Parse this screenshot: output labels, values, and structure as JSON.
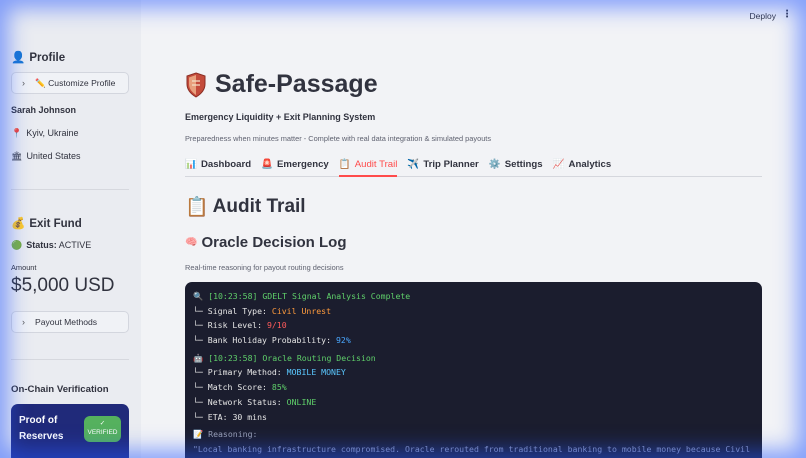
{
  "header": {
    "deploy_label": "Deploy",
    "menu_icon": "⋮"
  },
  "sidebar": {
    "profile_heading": "Profile",
    "profile_icon": "👤",
    "customize_button": "✏️ Customize Profile",
    "user_name": "Sarah Johnson",
    "location": "Kyiv, Ukraine",
    "location_icon": "📍",
    "citizenship": "United States",
    "citizenship_icon": "🏛",
    "exit_fund_heading": "Exit Fund",
    "exit_fund_icon": "💰",
    "status_label": "Status:",
    "status_value": "ACTIVE",
    "status_icon": "🟢",
    "amount_label": "Amount",
    "amount_value": "$5,000 USD",
    "payout_button": "Payout Methods",
    "onchain_heading": "On-Chain Verification",
    "proof_title": "Proof of Reserves",
    "verified_check": "✓",
    "verified_label": "VERIFIED",
    "proof_color": "#202a7a",
    "verified_color": "#55b15e"
  },
  "main": {
    "app_title": "Safe-Passage",
    "subtitle": "Emergency Liquidity + Exit Planning System",
    "caption": "Preparedness when minutes matter - Complete with real data integration & simulated payouts",
    "tabs": [
      {
        "icon": "📊",
        "label": "Dashboard"
      },
      {
        "icon": "🚨",
        "label": "Emergency"
      },
      {
        "icon": "📋",
        "label": "Audit Trail"
      },
      {
        "icon": "✈️",
        "label": "Trip Planner"
      },
      {
        "icon": "⚙️",
        "label": "Settings"
      },
      {
        "icon": "📈",
        "label": "Analytics"
      }
    ],
    "active_tab": "Audit Trail",
    "accent_color": "#ff4b4b",
    "section_title": "Audit Trail",
    "section_icon": "📋",
    "sub_title": "Oracle Decision Log",
    "sub_icon": "🧠",
    "sub_caption": "Real-time reasoning for payout routing decisions"
  },
  "console": {
    "signal_icon": "🔍",
    "signal_header": "[10:23:58] GDELT Signal Analysis Complete",
    "signal_type_label": "└─ Signal Type:",
    "signal_type_value": "Civil Unrest",
    "risk_label": "└─ Risk Level:",
    "risk_value": "9/10",
    "holiday_label": "└─ Bank Holiday Probability:",
    "holiday_value": "92%",
    "routing_icon": "🤖",
    "routing_header": "[10:23:58] Oracle Routing Decision",
    "method_label": "└─ Primary Method:",
    "method_value": "MOBILE MONEY",
    "match_label": "└─ Match Score:",
    "match_value": "85%",
    "network_label": "└─ Network Status:",
    "network_value": "ONLINE",
    "eta_label": "└─ ETA:",
    "eta_value": "30 mins",
    "reasoning_icon": "📝",
    "reasoning_label": "Reasoning:",
    "reasoning_text": "\"Local banking infrastructure compromised. Oracle rerouted from traditional banking to mobile money because Civil Unrest"
  }
}
